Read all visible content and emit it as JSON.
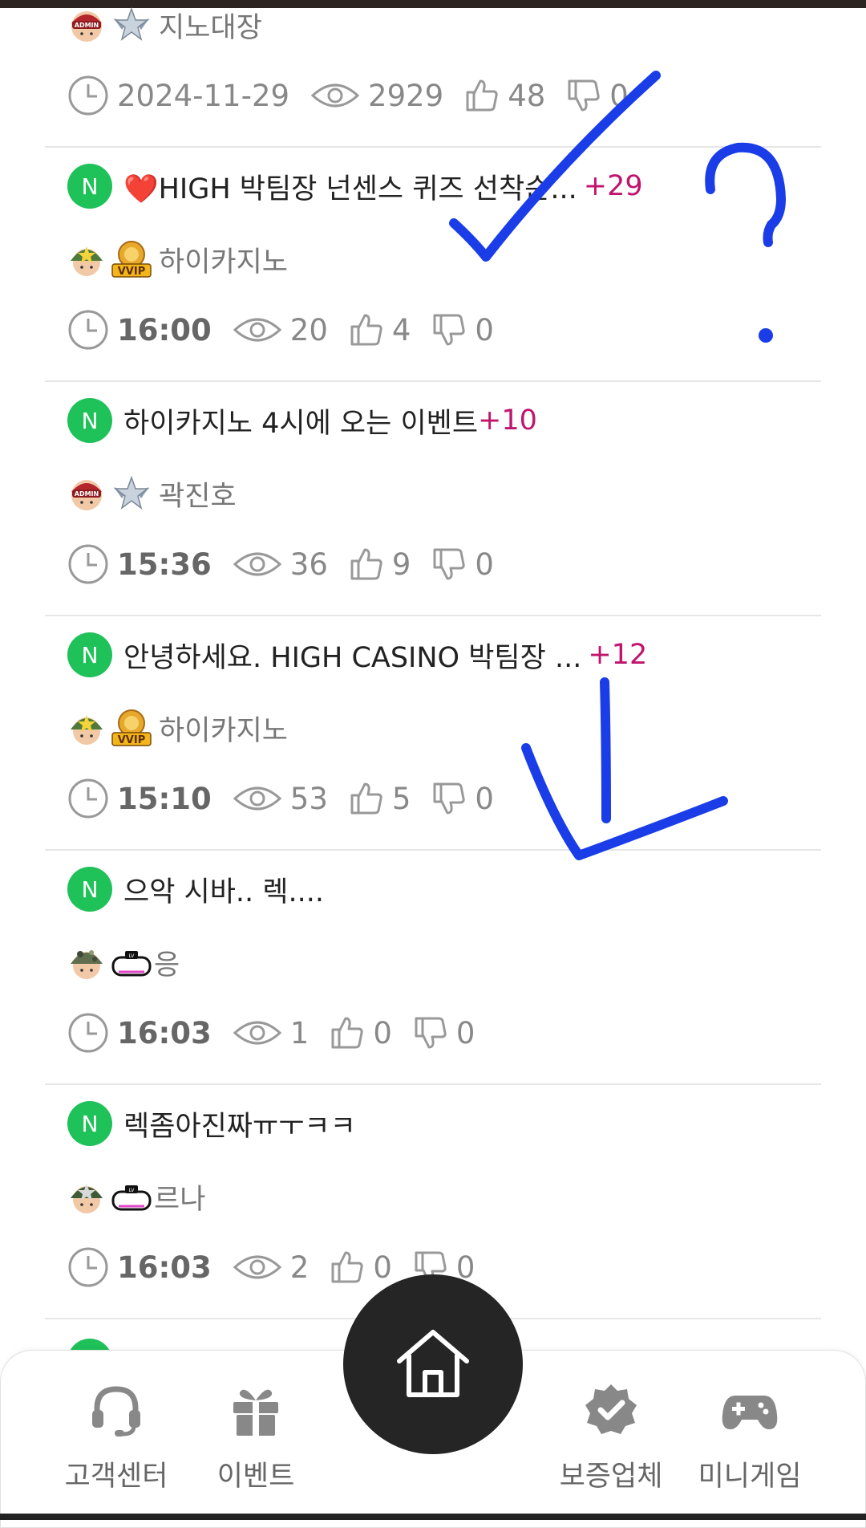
{
  "posts": [
    {
      "author": "지노대장",
      "rank_icon": "admin-badge",
      "level_icon": "winged-star-badge",
      "time": "2024-11-29",
      "views": "2929",
      "likes": "48",
      "dislikes": "0"
    },
    {
      "badge": "N",
      "title": "❤️HIGH 박팀장 넌센스 퀴즈 선착순...",
      "comments": "+29",
      "author": "하이카지노",
      "rank_icon": "green-helmet-star",
      "level_icon": "vvip-badge",
      "time": "16:00",
      "views": "20",
      "likes": "4",
      "dislikes": "0"
    },
    {
      "badge": "N",
      "title": "하이카지노 4시에 오는 이벤트",
      "comments": "+10",
      "author": "곽진호",
      "rank_icon": "admin-badge",
      "level_icon": "winged-star-badge",
      "time": "15:36",
      "views": "36",
      "likes": "9",
      "dislikes": "0"
    },
    {
      "badge": "N",
      "title": "안녕하세요. HIGH CASINO 박팀장 ...",
      "comments": "+12",
      "author": "하이카지노",
      "rank_icon": "green-helmet-star",
      "level_icon": "vvip-badge",
      "time": "15:10",
      "views": "53",
      "likes": "5",
      "dislikes": "0"
    },
    {
      "badge": "N",
      "title": "으악 시바.. 렉....",
      "comments": "",
      "author": "응",
      "rank_icon": "camo-helmet",
      "level_icon": "lv-badge",
      "time": "16:03",
      "views": "1",
      "likes": "0",
      "dislikes": "0"
    },
    {
      "badge": "N",
      "title": "렉좀아진짜ㅠㅜㅋㅋ",
      "comments": "",
      "author": "르나",
      "rank_icon": "dark-helmet-star",
      "level_icon": "lv-badge",
      "time": "16:03",
      "views": "2",
      "likes": "0",
      "dislikes": "0"
    }
  ],
  "nav": {
    "customer_center": "고객센터",
    "events": "이벤트",
    "home_icon": "home-icon",
    "verified": "보증업체",
    "minigame": "미니게임"
  },
  "colors": {
    "new_badge": "#1fc159",
    "comment_count": "#c0146d",
    "annotation": "#1a3de8"
  }
}
